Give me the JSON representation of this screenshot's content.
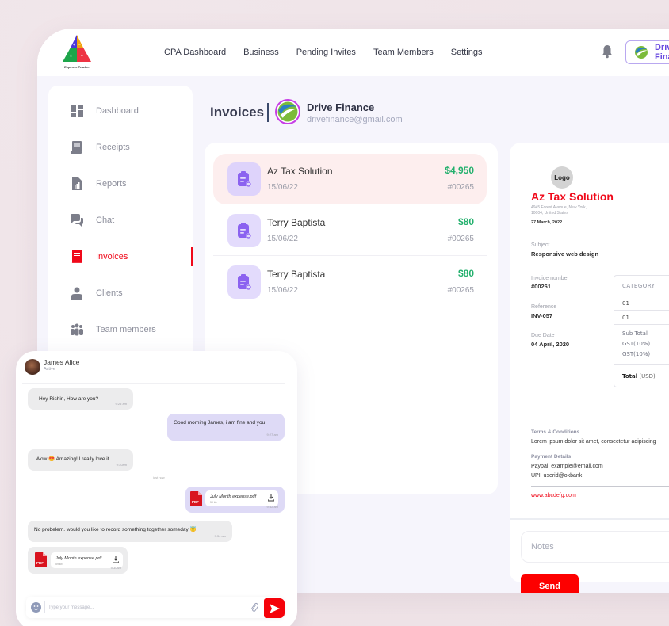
{
  "app": {
    "logo_caption": "Expense Tracker"
  },
  "topnav": {
    "items": [
      {
        "label": "CPA Dashboard"
      },
      {
        "label": "Business"
      },
      {
        "label": "Pending Invites"
      },
      {
        "label": "Team Members"
      },
      {
        "label": "Settings"
      }
    ],
    "notification_icon": "bell-icon",
    "account_button_label": "Drive Finance"
  },
  "sidebar": {
    "items": [
      {
        "label": "Dashboard",
        "icon": "dashboard-icon"
      },
      {
        "label": "Receipts",
        "icon": "receipt-icon"
      },
      {
        "label": "Reports",
        "icon": "report-icon"
      },
      {
        "label": "Chat",
        "icon": "chat-icon"
      },
      {
        "label": "Invoices",
        "icon": "invoice-icon",
        "active": true
      },
      {
        "label": "Clients",
        "icon": "client-icon"
      },
      {
        "label": "Team members",
        "icon": "team-icon"
      }
    ]
  },
  "header": {
    "title": "Invoices",
    "client_name": "Drive Finance",
    "client_email": "drivefinance@gmail.com"
  },
  "invoices": [
    {
      "name": "Az Tax Solution",
      "date": "15/06/22",
      "amount": "$4,950",
      "number": "#00265",
      "selected": true
    },
    {
      "name": "Terry Baptista",
      "date": "15/06/22",
      "amount": "$80",
      "number": "#00265"
    },
    {
      "name": "Terry Baptista",
      "date": "15/06/22",
      "amount": "$80",
      "number": "#00265"
    }
  ],
  "invoice_detail": {
    "logo_label": "Logo",
    "business_name": "Az Tax Solution",
    "address_line1": "4945 Forest Avenue, New York,",
    "address_line2": "10004, United States",
    "issue_date": "27 March, 2022",
    "subject_label": "Subject",
    "subject": "Responsive web design",
    "invoice_number_label": "Invoice number",
    "invoice_number": "#00261",
    "reference_label": "Reference",
    "reference": "INV-057",
    "due_date_label": "Due Date",
    "due_date": "04 April, 2020",
    "table": {
      "header": "CATEGORY",
      "rows": [
        "01",
        "01"
      ],
      "subtotal_label": "Sub Total",
      "tax_labels": [
        "GST(10%)",
        "GST(10%)"
      ],
      "total_label": "Total",
      "total_currency": "(USD)"
    },
    "terms_label": "Terms & Conditions",
    "terms_text": "Lorem ipsum dolor sit amet, consectetur adipiscing",
    "payment_label": "Payment Details",
    "paypal": "Paypal: example@email.com",
    "upi": "UPI: userid@okbank",
    "website": "www.abcdefg.com",
    "notes_placeholder": "Notes",
    "send_label": "Send"
  },
  "chat": {
    "contact_name": "James Alice",
    "contact_status": "Active",
    "messages": [
      {
        "text": "Hey Rishin, How are you?",
        "time": "9:25 am",
        "direction": "in"
      },
      {
        "text": "Good morning James, i am fine and you",
        "time": "9:27 am",
        "direction": "out"
      },
      {
        "text": "Wow 😍 Amazing! I really love it",
        "time": "9:30am",
        "direction": "in"
      },
      {
        "file_name": "July Month expense.pdf",
        "file_size": "59 kb",
        "time": "9:32 am",
        "direction": "out"
      },
      {
        "text": "No probelem. would you like to record something together someday 😇",
        "time": "9:34 am",
        "direction": "in"
      },
      {
        "file_name": "July Month expense.pdf",
        "file_size": "59 kb",
        "time": "9:30am",
        "direction": "in"
      }
    ],
    "divider_label": "just now",
    "input_placeholder": "Type your message..."
  },
  "colors": {
    "accent_red": "#f0091a",
    "amount_green": "#23b06d",
    "purple": "#8b62f0",
    "outgoing_bubble": "#dedaf6",
    "incoming_bubble": "#ececed"
  }
}
